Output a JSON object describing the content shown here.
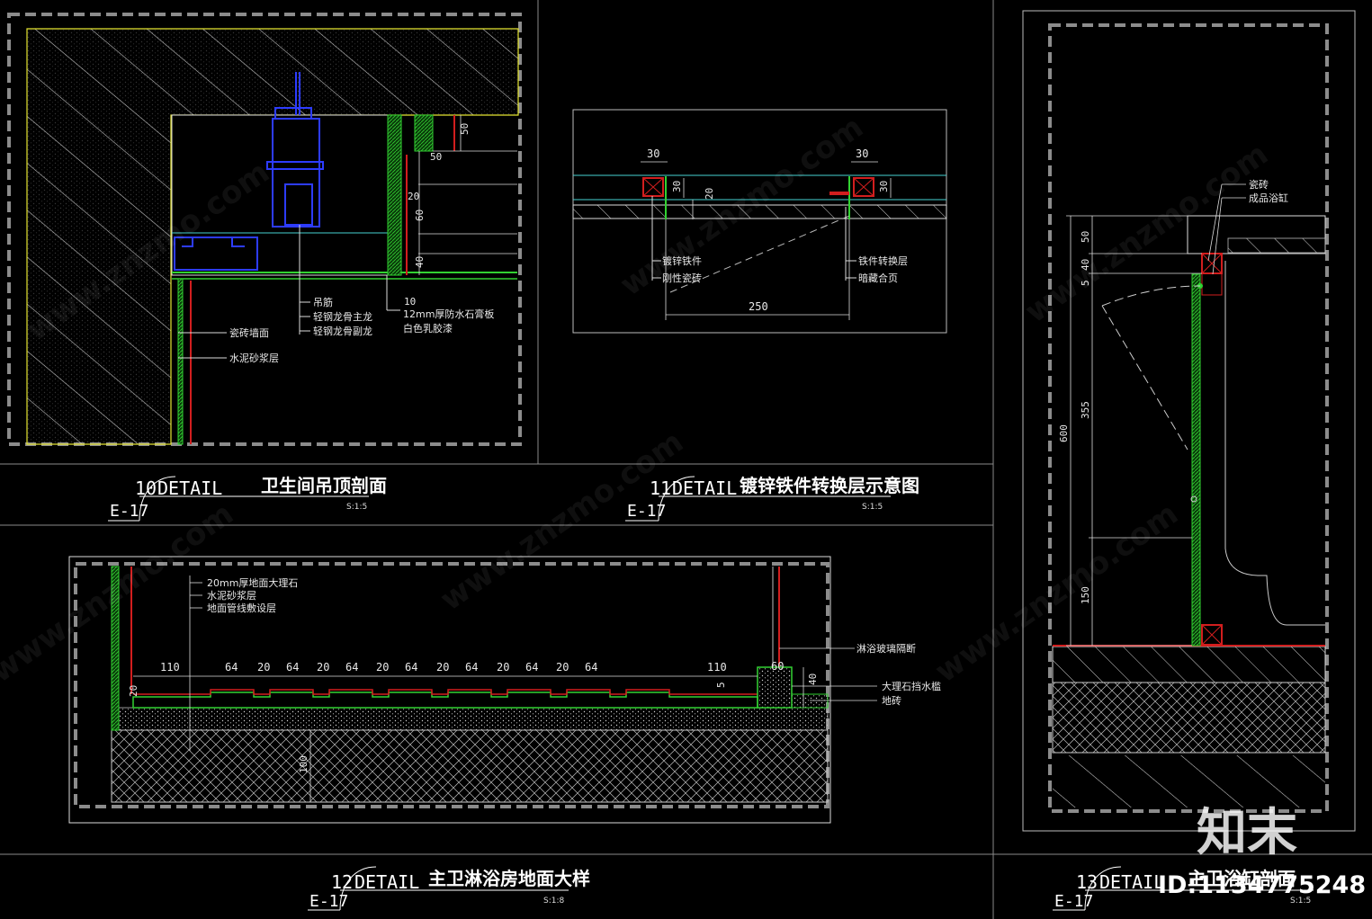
{
  "details": [
    {
      "number": "10",
      "prefix": "DETAIL",
      "title": "卫生间吊顶剖面",
      "sheet": "E-17",
      "scale": "S:1:5",
      "labels": [
        "吊筋",
        "轻钢龙骨主龙",
        "轻钢龙骨副龙",
        "12mm厚防水石膏板",
        "白色乳胶漆",
        "瓷砖墙面",
        "水泥砂浆层"
      ],
      "dims": [
        "50",
        "50",
        "20",
        "60",
        "40",
        "10"
      ]
    },
    {
      "number": "11",
      "prefix": "DETAIL",
      "title": "镀锌铁件转换层示意图",
      "sheet": "E-17",
      "scale": "S:1:5",
      "labels": [
        "镀锌铁件",
        "刚性瓷砖",
        "铁件转换层",
        "暗藏合页"
      ],
      "dims": [
        "30",
        "30",
        "30",
        "30",
        "20",
        "250"
      ]
    },
    {
      "number": "12",
      "prefix": "DETAIL",
      "title": "主卫淋浴房地面大样",
      "sheet": "E-17",
      "scale": "S:1:8",
      "labels": [
        "20mm厚地面大理石",
        "水泥砂浆层",
        "地面管线敷设层",
        "淋浴玻璃隔断",
        "大理石挡水槛",
        "地砖"
      ],
      "dims": [
        "110",
        "64",
        "20",
        "64",
        "20",
        "64",
        "20",
        "64",
        "20",
        "64",
        "20",
        "64",
        "20",
        "64",
        "110",
        "60",
        "40",
        "20",
        "5",
        "100"
      ]
    },
    {
      "number": "13",
      "prefix": "DETAIL",
      "title": "主卫浴缸剖面",
      "sheet": "E-17",
      "scale": "S:1:5",
      "labels": [
        "瓷砖",
        "成品浴缸"
      ],
      "dims": [
        "50",
        "40",
        "5",
        "355",
        "150",
        "600"
      ]
    }
  ],
  "watermark": {
    "text": "www.znzmo.com",
    "brand": "知末",
    "id": "ID:1134775248"
  },
  "colors": {
    "background": "#000000",
    "frame_dashed": "#8c8c8c",
    "wall_yellow": "#e6e632",
    "tile_red": "#d21e1e",
    "finish_green": "#32d232",
    "steel_blue": "#2d3cff",
    "dim_cyan": "#46d2d2"
  }
}
